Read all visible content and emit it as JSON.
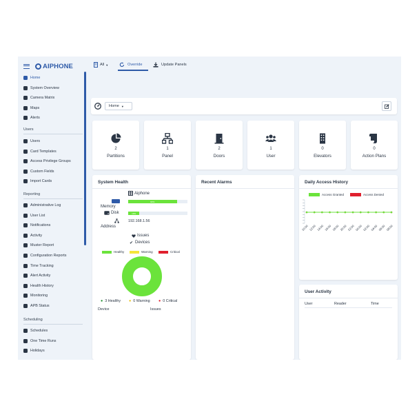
{
  "brand": {
    "name": "AIPHONE"
  },
  "sidebar": {
    "main": [
      {
        "label": "Home",
        "icon": "dashboard-icon"
      },
      {
        "label": "System Overview",
        "icon": "globe-icon"
      },
      {
        "label": "Camera Matrix",
        "icon": "camera-icon"
      },
      {
        "label": "Maps",
        "icon": "map-icon"
      },
      {
        "label": "Alerts",
        "icon": "bell-icon"
      }
    ],
    "users_title": "Users",
    "users": [
      {
        "label": "Users",
        "icon": "user-icon"
      },
      {
        "label": "Card Templates",
        "icon": "card-icon"
      },
      {
        "label": "Access Privilege Groups",
        "icon": "group-icon"
      },
      {
        "label": "Custom Fields",
        "icon": "pencil-icon"
      },
      {
        "label": "Import Cards",
        "icon": "import-icon"
      }
    ],
    "reporting_title": "Reporting",
    "reporting": [
      {
        "label": "Administrative Log",
        "icon": "user-log-icon"
      },
      {
        "label": "User List",
        "icon": "list-icon"
      },
      {
        "label": "Notifications",
        "icon": "bell-icon"
      },
      {
        "label": "Activity",
        "icon": "activity-icon"
      },
      {
        "label": "Muster Report",
        "icon": "fire-icon"
      },
      {
        "label": "Configuration Reports",
        "icon": "config-icon"
      },
      {
        "label": "Time Tracking",
        "icon": "clock-icon"
      },
      {
        "label": "Alert Activity",
        "icon": "alert-icon"
      },
      {
        "label": "Health History",
        "icon": "heart-icon"
      },
      {
        "label": "Monitoring",
        "icon": "eye-icon"
      },
      {
        "label": "APB Status",
        "icon": "apb-icon"
      }
    ],
    "scheduling_title": "Scheduling",
    "scheduling": [
      {
        "label": "Schedules",
        "icon": "calendar-icon"
      },
      {
        "label": "One Time Runs",
        "icon": "clock-icon"
      },
      {
        "label": "Holidays",
        "icon": "umbrella-icon"
      }
    ]
  },
  "topbar": {
    "site_select": "All",
    "override": "Override",
    "update_panels": "Update Panels"
  },
  "home": {
    "select": "Home"
  },
  "stats": [
    {
      "value": "2",
      "label": "Partitions",
      "icon": "pie-icon"
    },
    {
      "value": "1",
      "label": "Panel",
      "icon": "network-icon"
    },
    {
      "value": "2",
      "label": "Doors",
      "icon": "door-icon"
    },
    {
      "value": "1",
      "label": "User",
      "icon": "users-icon"
    },
    {
      "value": "0",
      "label": "Elevators",
      "icon": "building-icon"
    },
    {
      "value": "0",
      "label": "Action Plans",
      "icon": "scroll-icon"
    }
  ],
  "system_health": {
    "title": "System Health",
    "device": "Aiphone",
    "memory_label": "Memory",
    "memory_percent": 0.82,
    "memory_badge": "82%",
    "disk_label": "Disk",
    "disk_percent": 0.19,
    "disk_badge": "19%",
    "address_label": "Address",
    "address": "192.168.1.56",
    "issues_label": "Issues",
    "devices_label": "Devices",
    "legend": [
      {
        "label": "Healthy",
        "color": "#6be33b"
      },
      {
        "label": "Warning",
        "color": "#f5e53b"
      },
      {
        "label": "Critical",
        "color": "#e0202e"
      }
    ],
    "counts": [
      {
        "text": "3 Healthy",
        "color": "#1f8f2e"
      },
      {
        "text": "0 Warning",
        "color": "#e8c21b"
      },
      {
        "text": "0 Critical",
        "color": "#e0202e"
      }
    ],
    "table_headers": [
      "Device",
      "Issues"
    ]
  },
  "recent_alarms": {
    "title": "Recent Alarms"
  },
  "daily_access": {
    "title": "Daily Access History",
    "legend_granted": "Access Granted",
    "legend_denied": "Access Denied",
    "granted_color": "#6be33b",
    "denied_color": "#e0202e"
  },
  "chart_data": {
    "type": "line",
    "x": [
      "10:00",
      "12:00",
      "14:00",
      "16:00",
      "18:00",
      "20:00",
      "22:00",
      "00:00",
      "02:00",
      "04:00",
      "06:00",
      "08:00"
    ],
    "series": [
      {
        "name": "Access Granted",
        "values": [
          0,
          0,
          0,
          0,
          0,
          0,
          0,
          0,
          0,
          0,
          0,
          0
        ]
      },
      {
        "name": "Access Denied",
        "values": [
          0,
          0,
          0,
          0,
          0,
          0,
          0,
          0,
          0,
          0,
          0,
          0
        ]
      }
    ]
  },
  "user_activity": {
    "title": "User Activity",
    "headers": [
      "User",
      "Reader",
      "Time"
    ]
  }
}
